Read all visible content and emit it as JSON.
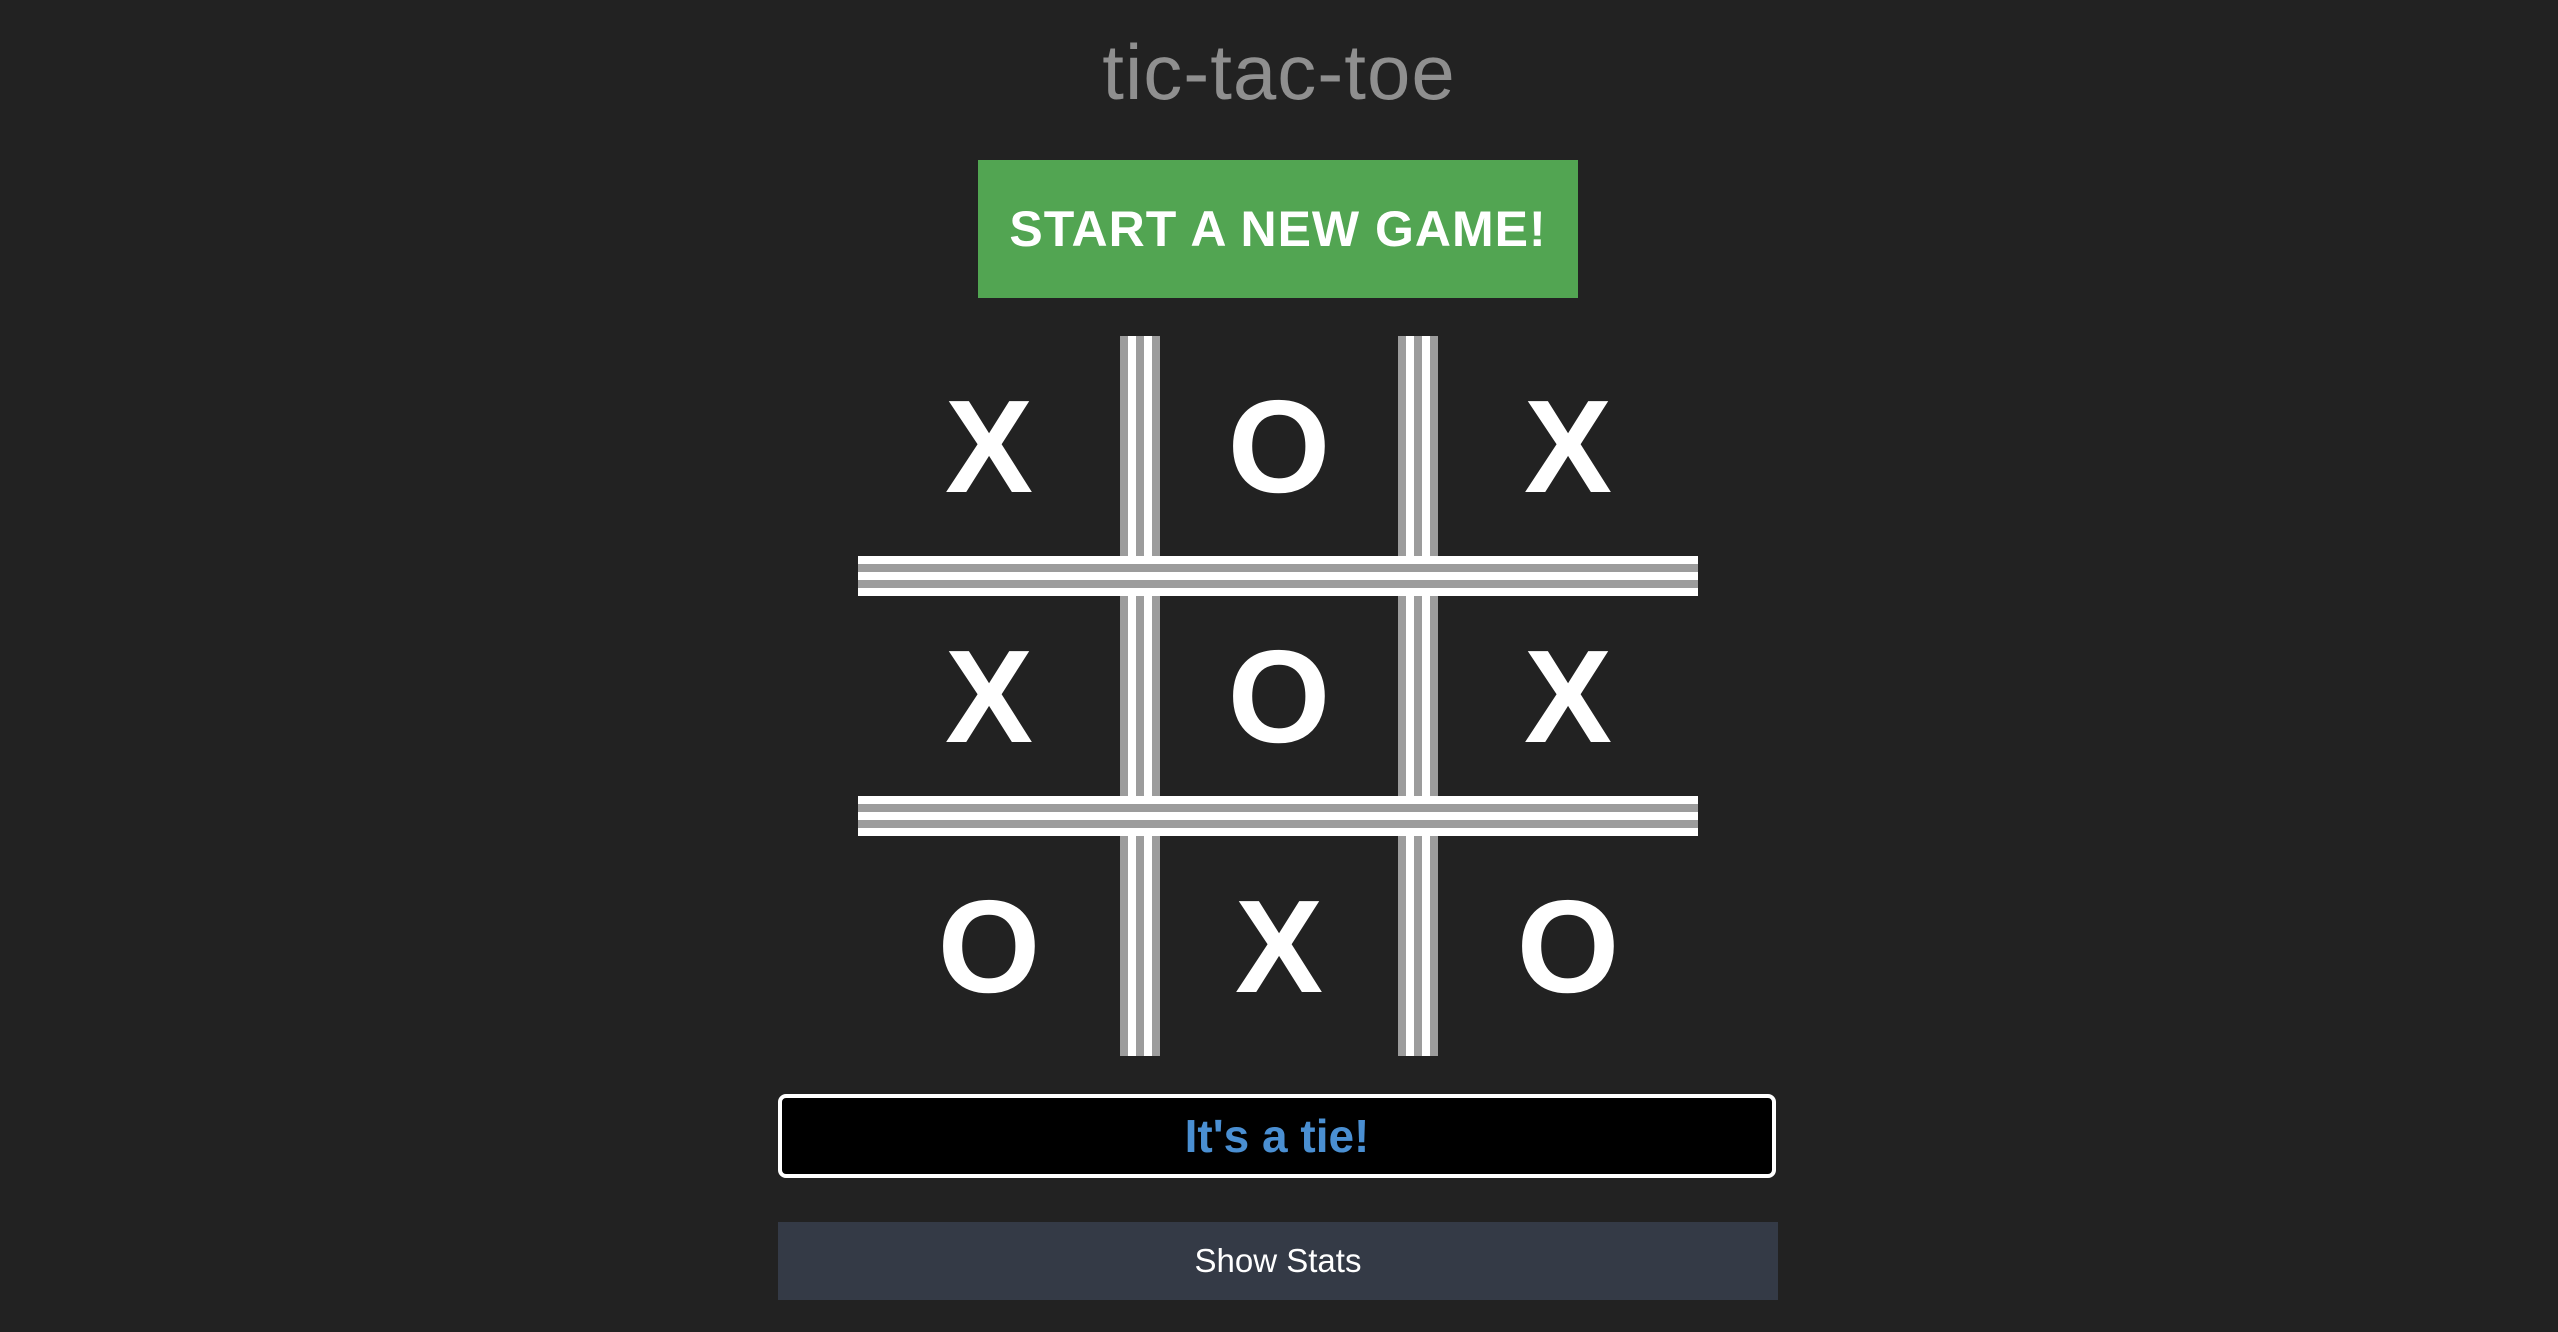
{
  "title": "tic-tac-toe",
  "new_game_button": "START A NEW GAME!",
  "board": {
    "cells": [
      "X",
      "O",
      "X",
      "X",
      "O",
      "X",
      "O",
      "X",
      "O"
    ]
  },
  "status": "It's a tie!",
  "stats_button": "Show Stats",
  "colors": {
    "background": "#222222",
    "title": "#8f8f8f",
    "new_game_button_bg": "#52a552",
    "status_text": "#4a8fd2",
    "stats_button_bg": "#343a46"
  }
}
